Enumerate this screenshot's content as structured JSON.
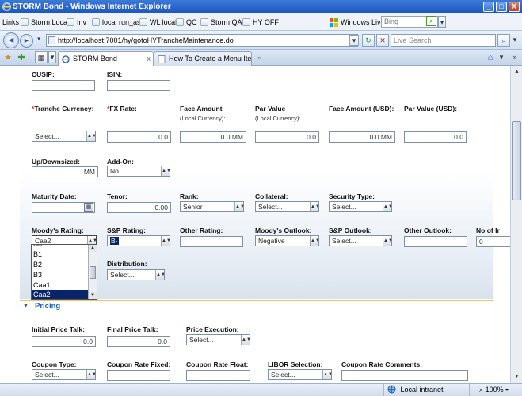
{
  "window": {
    "title": "STORM Bond - Windows Internet Explorer",
    "min_label": "_",
    "max_label": "□",
    "close_label": "X"
  },
  "links_bar": {
    "label": "Links",
    "items": [
      "Storm Local",
      "Inv",
      "local run_as",
      "WL local",
      "QC",
      "Storm QA",
      "HY OFF"
    ],
    "windows_live": "Windows Live",
    "bing_placeholder": "Bing"
  },
  "address_bar": {
    "back": "◄",
    "forward": "►",
    "url": "http://localhost:7001/hy/gotoHYTrancheMaintenance.do",
    "refresh": "↻",
    "stop": "✕",
    "search_placeholder": "Live Search",
    "search_btn": "⌕"
  },
  "tabs": [
    {
      "label": "STORM Bond",
      "active": true,
      "close": "x"
    },
    {
      "label": "How To Create a Menu Item ...",
      "active": false
    }
  ],
  "toolbar_icons": {
    "star": "★",
    "add_fav": "✚",
    "home": "⌂"
  },
  "form": {
    "cusip_label": "CUSIP:",
    "isin_label": "ISIN:",
    "tranche_currency_label": "Tranche Currency:",
    "tranche_currency_value": "Select...",
    "fx_rate_label": "FX Rate:",
    "fx_rate_value": "0.0",
    "face_amount_label": "Face Amount",
    "face_amount_sub": "(Local Currency):",
    "face_amount_value": "0.0 MM",
    "par_value_label": "Par Value",
    "par_value_sub": "(Local Currency):",
    "par_value_value": "0.0",
    "face_amount_usd_label": "Face Amount (USD):",
    "face_amount_usd_value": "0.0 MM",
    "par_value_usd_label": "Par Value (USD):",
    "par_value_usd_value": "0.0",
    "up_downsized_label": "Up/Downsized:",
    "up_downsized_value": "MM",
    "add_on_label": "Add-On:",
    "add_on_value": "No",
    "maturity_date_label": "Maturity Date:",
    "tenor_label": "Tenor:",
    "tenor_value": "0.00",
    "rank_label": "Rank:",
    "rank_value": "Senior",
    "collateral_label": "Collateral:",
    "collateral_value": "Select...",
    "security_type_label": "Security Type:",
    "security_type_value": "Select...",
    "moodys_rating_label": "Moody's Rating:",
    "moodys_rating_value": "Caa2",
    "sp_rating_label": "S&P Rating:",
    "sp_rating_value": "B-",
    "other_rating_label": "Other Rating:",
    "moodys_outlook_label": "Moody's Outlook:",
    "moodys_outlook_value": "Negative",
    "sp_outlook_label": "S&P Outlook:",
    "sp_outlook_value": "Select...",
    "other_outlook_label": "Other Outlook:",
    "no_of_label": "No of Ir",
    "no_of_value": "0",
    "distribution_label": "Distribution:",
    "distribution_value": "Select..."
  },
  "moodys_dropdown": {
    "options": [
      "B3",
      "B1",
      "B2",
      "B3",
      "Caa1",
      "Caa2"
    ],
    "selected_index": 5
  },
  "pricing": {
    "section_label": "Pricing",
    "initial_price_talk_label": "Initial Price Talk:",
    "initial_price_talk_value": "0.0",
    "final_price_talk_label": "Final Price Talk:",
    "final_price_talk_value": "0.0",
    "price_execution_label": "Price Execution:",
    "price_execution_value": "Select...",
    "coupon_type_label": "Coupon Type:",
    "coupon_type_value": "Select...",
    "coupon_rate_fixed_label": "Coupon Rate Fixed:",
    "coupon_rate_float_label": "Coupon Rate Float:",
    "libor_selection_label": "LIBOR Selection:",
    "libor_selection_value": "Select...",
    "coupon_rate_comments_label": "Coupon Rate Comments:"
  },
  "status_bar": {
    "zone": "Local intranet",
    "zoom": "100%"
  }
}
